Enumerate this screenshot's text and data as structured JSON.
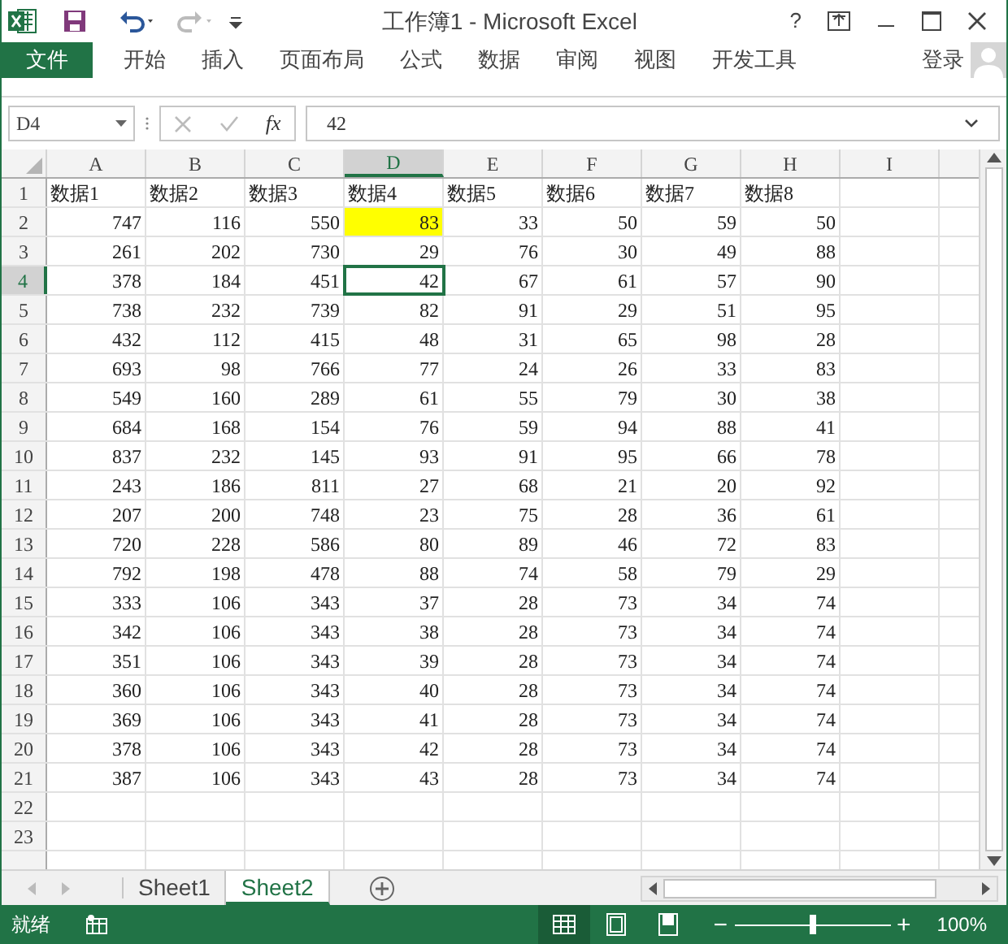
{
  "title_bar": {
    "title": "工作簿1 - Microsoft Excel",
    "help": "?"
  },
  "file_button": "文件",
  "ribbon_tabs": [
    {
      "label": "开始",
      "selected": false
    },
    {
      "label": "插入",
      "selected": false
    },
    {
      "label": "页面布局",
      "selected": false
    },
    {
      "label": "公式",
      "selected": false
    },
    {
      "label": "数据",
      "selected": false
    },
    {
      "label": "审阅",
      "selected": false
    },
    {
      "label": "视图",
      "selected": false
    },
    {
      "label": "开发工具",
      "selected": false
    }
  ],
  "sign_in": "登录",
  "formula_bar": {
    "name_box": "D4",
    "function_label": "fx",
    "value": "42"
  },
  "columns": [
    {
      "label": "A",
      "selected": false
    },
    {
      "label": "B",
      "selected": false
    },
    {
      "label": "C",
      "selected": false
    },
    {
      "label": "D",
      "selected": true
    },
    {
      "label": "E",
      "selected": false
    },
    {
      "label": "F",
      "selected": false
    },
    {
      "label": "G",
      "selected": false
    },
    {
      "label": "H",
      "selected": false
    },
    {
      "label": "I",
      "selected": false
    }
  ],
  "rows": [
    {
      "label": "1",
      "selected": false,
      "cells": [
        "数据1",
        "数据2",
        "数据3",
        "数据4",
        "数据5",
        "数据6",
        "数据7",
        "数据8"
      ]
    },
    {
      "label": "2",
      "selected": false,
      "cells": [
        "747",
        "116",
        "550",
        {
          "text": "83",
          "color": "#ffff00"
        },
        "33",
        "50",
        "59",
        "50"
      ]
    },
    {
      "label": "3",
      "selected": false,
      "cells": [
        "261",
        "202",
        "730",
        "29",
        "76",
        "30",
        "49",
        "88"
      ]
    },
    {
      "label": "4",
      "selected": true,
      "cells": [
        "378",
        "184",
        "451",
        "42",
        "67",
        "61",
        "57",
        "90"
      ]
    },
    {
      "label": "5",
      "selected": false,
      "cells": [
        "738",
        "232",
        "739",
        "82",
        "91",
        "29",
        "51",
        "95"
      ]
    },
    {
      "label": "6",
      "selected": false,
      "cells": [
        "432",
        "112",
        "415",
        "48",
        "31",
        "65",
        "98",
        "28"
      ]
    },
    {
      "label": "7",
      "selected": false,
      "cells": [
        "693",
        "98",
        "766",
        "77",
        "24",
        "26",
        "33",
        "83"
      ]
    },
    {
      "label": "8",
      "selected": false,
      "cells": [
        "549",
        "160",
        "289",
        "61",
        "55",
        "79",
        "30",
        "38"
      ]
    },
    {
      "label": "9",
      "selected": false,
      "cells": [
        "684",
        "168",
        "154",
        "76",
        "59",
        "94",
        "88",
        "41"
      ]
    },
    {
      "label": "10",
      "selected": false,
      "cells": [
        "837",
        "232",
        "145",
        "93",
        "91",
        "95",
        "66",
        "78"
      ]
    },
    {
      "label": "11",
      "selected": false,
      "cells": [
        "243",
        "186",
        "811",
        "27",
        "68",
        "21",
        "20",
        "92"
      ]
    },
    {
      "label": "12",
      "selected": false,
      "cells": [
        "207",
        "200",
        "748",
        "23",
        "75",
        "28",
        "36",
        "61"
      ]
    },
    {
      "label": "13",
      "selected": false,
      "cells": [
        "720",
        "228",
        "586",
        "80",
        "89",
        "46",
        "72",
        "83"
      ]
    },
    {
      "label": "14",
      "selected": false,
      "cells": [
        "792",
        "198",
        "478",
        "88",
        "74",
        "58",
        "79",
        "29"
      ]
    },
    {
      "label": "15",
      "selected": false,
      "cells": [
        "333",
        "106",
        "343",
        "37",
        "28",
        "73",
        "34",
        "74"
      ]
    },
    {
      "label": "16",
      "selected": false,
      "cells": [
        "342",
        "106",
        "343",
        "38",
        "28",
        "73",
        "34",
        "74"
      ]
    },
    {
      "label": "17",
      "selected": false,
      "cells": [
        "351",
        "106",
        "343",
        "39",
        "28",
        "73",
        "34",
        "74"
      ]
    },
    {
      "label": "18",
      "selected": false,
      "cells": [
        "360",
        "106",
        "343",
        "40",
        "28",
        "73",
        "34",
        "74"
      ]
    },
    {
      "label": "19",
      "selected": false,
      "cells": [
        "369",
        "106",
        "343",
        "41",
        "28",
        "73",
        "34",
        "74"
      ]
    },
    {
      "label": "20",
      "selected": false,
      "cells": [
        "378",
        "106",
        "343",
        "42",
        "28",
        "73",
        "34",
        "74"
      ]
    },
    {
      "label": "21",
      "selected": false,
      "cells": [
        "387",
        "106",
        "343",
        "43",
        "28",
        "73",
        "34",
        "74"
      ]
    },
    {
      "label": "22",
      "selected": false
    },
    {
      "label": "23",
      "selected": false
    }
  ],
  "sheet_tabs": [
    {
      "label": "Sheet1",
      "selected": false
    },
    {
      "label": "Sheet2",
      "selected": true
    }
  ],
  "status_bar": {
    "status": "就绪",
    "views": [
      {
        "kind": "normal",
        "selected": true
      },
      {
        "kind": "page_layout",
        "selected": false
      },
      {
        "kind": "page_break",
        "selected": false
      }
    ],
    "zoom": {
      "zoom_out": "−",
      "level": 0.5,
      "zoom_in": "+",
      "reading": "100%"
    }
  }
}
